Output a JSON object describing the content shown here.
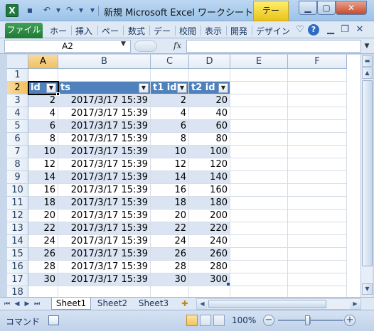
{
  "app": {
    "title": "新規 Microsoft Excel ワークシート.x...",
    "context_tab": "テー",
    "icon_letter": "X"
  },
  "ribbon": {
    "file_tab": "ファイル",
    "tabs": [
      "ホー",
      "挿入",
      "ペー",
      "数式",
      "デー",
      "校閲",
      "表示",
      "開発",
      "デザイン"
    ]
  },
  "formula_bar": {
    "name_box": "A2",
    "fx": "fx",
    "value": ""
  },
  "grid": {
    "columns": [
      "A",
      "B",
      "C",
      "D",
      "E",
      "F"
    ],
    "active_column": "A",
    "active_row": 2,
    "rows": [
      "1",
      "2",
      "3",
      "4",
      "5",
      "6",
      "7",
      "8",
      "9",
      "10",
      "11",
      "12",
      "13",
      "14",
      "15",
      "16",
      "17",
      "18"
    ],
    "table_headers": [
      "id",
      "ts",
      "t1 id",
      "t2 id"
    ],
    "table_rows": [
      [
        "2",
        "2017/3/17 15:39",
        "2",
        "20"
      ],
      [
        "4",
        "2017/3/17 15:39",
        "4",
        "40"
      ],
      [
        "6",
        "2017/3/17 15:39",
        "6",
        "60"
      ],
      [
        "8",
        "2017/3/17 15:39",
        "8",
        "80"
      ],
      [
        "10",
        "2017/3/17 15:39",
        "10",
        "100"
      ],
      [
        "12",
        "2017/3/17 15:39",
        "12",
        "120"
      ],
      [
        "14",
        "2017/3/17 15:39",
        "14",
        "140"
      ],
      [
        "16",
        "2017/3/17 15:39",
        "16",
        "160"
      ],
      [
        "18",
        "2017/3/17 15:39",
        "18",
        "180"
      ],
      [
        "20",
        "2017/3/17 15:39",
        "20",
        "200"
      ],
      [
        "22",
        "2017/3/17 15:39",
        "22",
        "220"
      ],
      [
        "24",
        "2017/3/17 15:39",
        "24",
        "240"
      ],
      [
        "26",
        "2017/3/17 15:39",
        "26",
        "260"
      ],
      [
        "28",
        "2017/3/17 15:39",
        "28",
        "280"
      ],
      [
        "30",
        "2017/3/17 15:39",
        "30",
        "300"
      ]
    ],
    "table_header_color": "#4f81bd",
    "band_color": "#dae4f2"
  },
  "sheets": {
    "tabs": [
      "Sheet1",
      "Sheet2",
      "Sheet3"
    ],
    "active": "Sheet1"
  },
  "status": {
    "mode": "コマンド",
    "zoom": "100%",
    "zoom_level_percent": 100
  }
}
